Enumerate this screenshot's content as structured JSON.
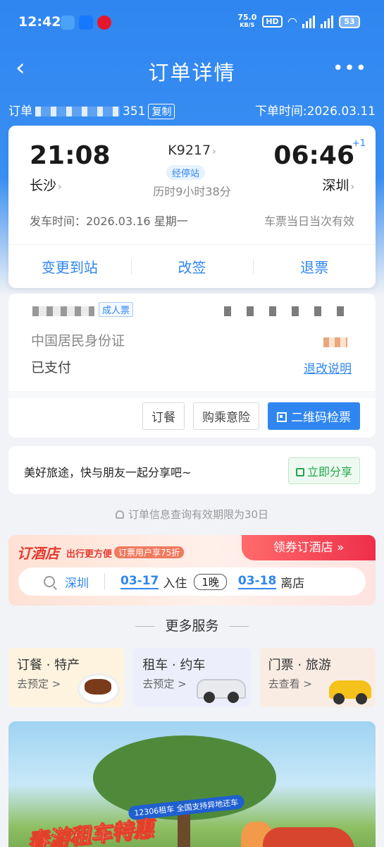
{
  "status_bar": {
    "time": "12:42",
    "net_speed": "75.0",
    "net_unit": "KB/S",
    "hd": "HD",
    "battery": "53"
  },
  "header": {
    "title": "订单详情",
    "back_icon": "back-arrow-icon",
    "more_icon": "more-dots-icon"
  },
  "order": {
    "number_prefix": "订单",
    "number_suffix": "351",
    "copy_label": "复制",
    "order_time": "下单时间:2026.03.11"
  },
  "trip": {
    "depart_time": "21:08",
    "arrive_time": "06:46",
    "plus_day": "+1",
    "depart_station": "长沙",
    "arrive_station": "深圳",
    "train_no": "K9217",
    "stops_label": "经停站",
    "duration": "历时9小时38分",
    "depart_date": "发车时间：2026.03.16 星期一",
    "valid_note": "车票当日当次有效",
    "actions": [
      "变更到站",
      "改签",
      "退票"
    ]
  },
  "passenger": {
    "ticket_type": "成人票",
    "id_type": "中国居民身份证",
    "pay_status": "已支付",
    "refund_rule": "退改说明",
    "buttons": [
      "订餐",
      "购乘意险",
      "二维码检票"
    ]
  },
  "share": {
    "text": "美好旅途，快与朋友一起分享吧~",
    "button": "立即分享"
  },
  "notice": "订单信息查询有效期限为30日",
  "hotel": {
    "logo": "订酒店",
    "slogan": "出行更方便",
    "badge": "订票用户享75折",
    "coupon": "领券订酒店 »",
    "city": "深圳",
    "checkin_date": "03-17",
    "checkin_label": "入住",
    "nights": "1晚",
    "checkout_date": "03-18",
    "checkout_label": "离店"
  },
  "more_services": {
    "title": "更多服务",
    "items": [
      {
        "title": "订餐 · 特产",
        "sub": "去预定 >"
      },
      {
        "title": "租车 · 约车",
        "sub": "去预定 >"
      },
      {
        "title": "门票 · 旅游",
        "sub": "去查看 >"
      }
    ]
  },
  "banner": {
    "tag": "12306租车 全国支持异地还车",
    "title": "春游租车特惠"
  },
  "colors": {
    "primary": "#2f86f0",
    "hotel_red": "#e53a2f",
    "share_green": "#21a54a"
  }
}
